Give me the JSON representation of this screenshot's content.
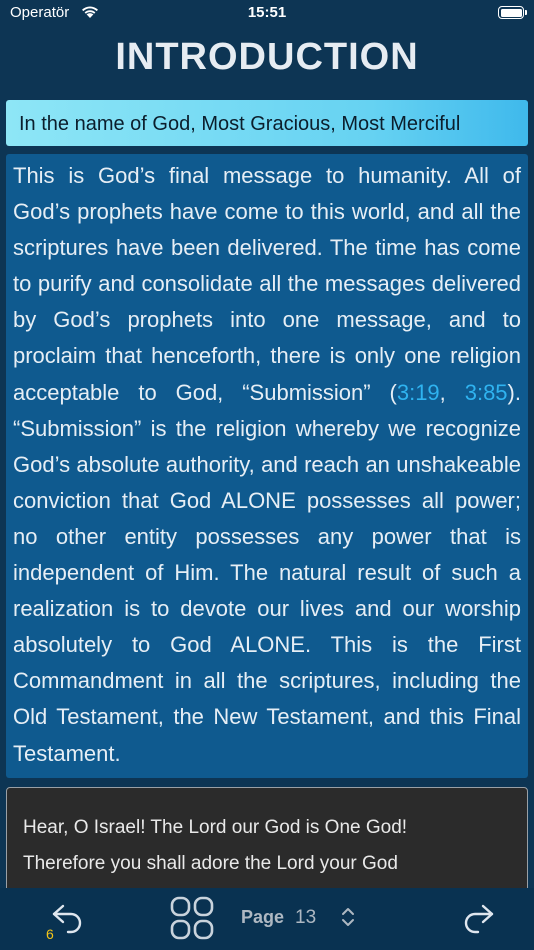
{
  "status_bar": {
    "carrier": "Operatör",
    "time": "15:51"
  },
  "title": "INTRODUCTION",
  "basmala": "In the name of God, Most Gracious, Most Merciful",
  "intro": {
    "text_1": "This is God’s final message to humanity. All of God’s prophets have come to this world, and all the scriptures have been delivered. The time has come to purify and consolidate all the messages delivered by God’s prophets into one message, and to proclaim that henceforth, there is only one religion acceptable to God, “Submission” (",
    "ref_1": "3:19",
    "sep": ", ",
    "ref_2": "3:85",
    "text_2": "). “Submission” is the religion whereby we recognize God’s absolute authority, and reach an unshakeable conviction that God ALONE pos­sesses all power; no other entity possesses any power that is independent of Him. The natural result of such a realization is to devote our lives and our worship absolutely to God ALONE. This is the First Commandment in all the scriptures, including the Old Testament, the New Testa­ment, and this Final Testament."
  },
  "quote": {
    "lines": [
      "Hear, O Israel! The Lord our God is One God!",
      "Therefore you shall adore the Lord your God"
    ]
  },
  "toolbar": {
    "back_count": "6",
    "page_label": "Page",
    "page_number": "13"
  },
  "colors": {
    "background": "#0d3554",
    "intro_box": "#0f5a8f",
    "link": "#2fb3f0",
    "basmala_gradient_start": "#8ee6f6",
    "basmala_gradient_end": "#3fb9ec",
    "quote_box": "#2b2b2b",
    "toolbar": "#093251",
    "back_count": "#f5c518"
  },
  "icons": {
    "wifi": "wifi-icon",
    "battery": "battery-icon",
    "back": "undo-arrow-icon",
    "grid": "grid-icon",
    "stepper": "chevron-up-down-icon",
    "forward": "redo-arrow-icon"
  }
}
